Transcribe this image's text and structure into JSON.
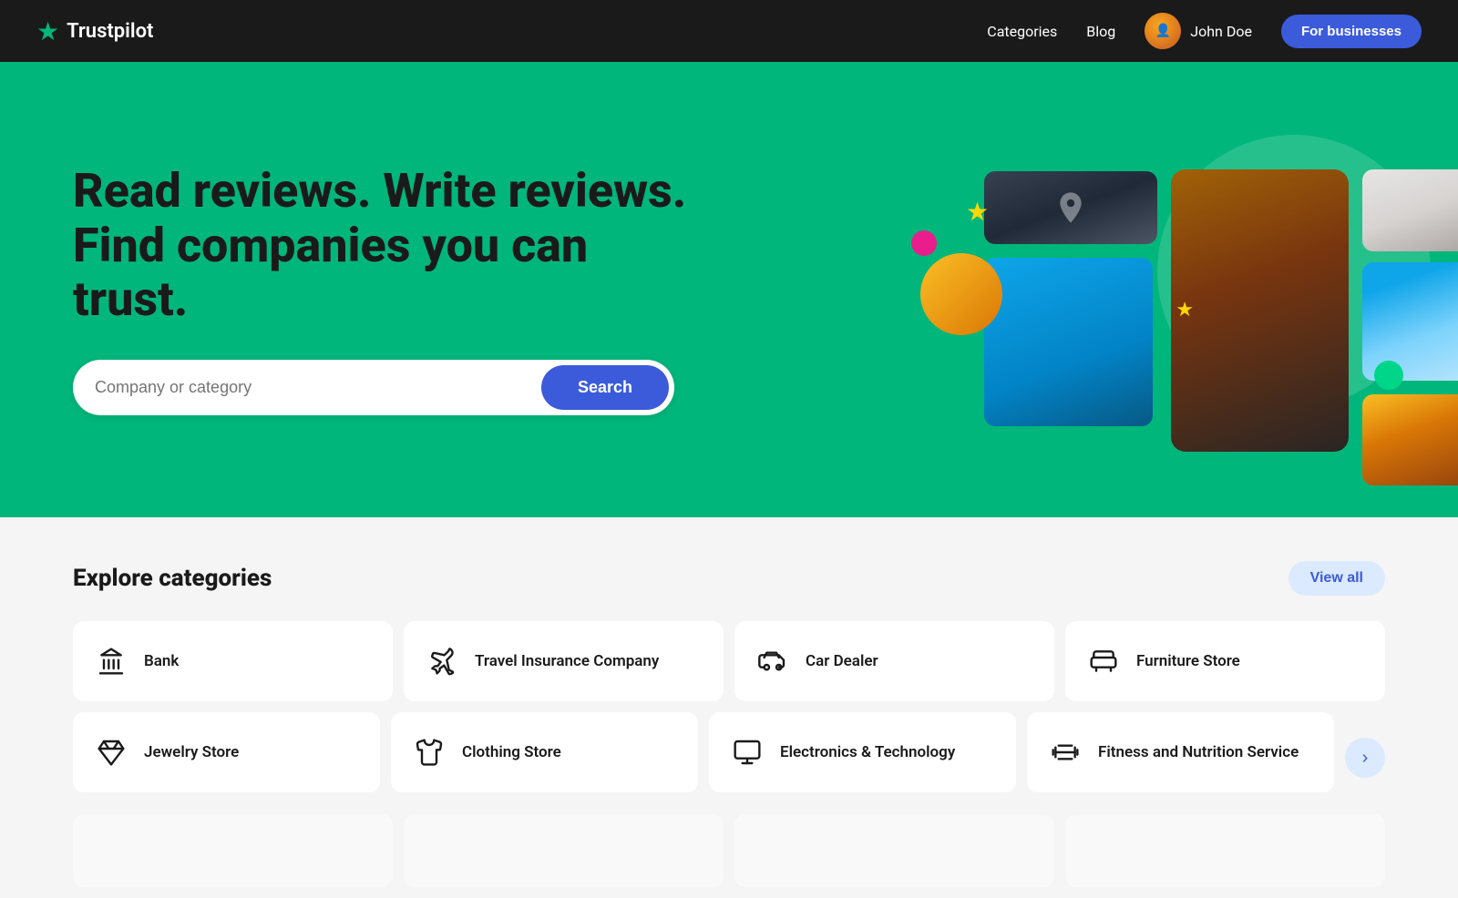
{
  "navbar": {
    "logo_text": "Trustpilot",
    "nav_links": [
      {
        "label": "Categories",
        "id": "categories-link"
      },
      {
        "label": "Blog",
        "id": "blog-link"
      }
    ],
    "user_name": "John Doe",
    "for_businesses_label": "For businesses"
  },
  "hero": {
    "title_line1": "Read reviews. Write reviews.",
    "title_line2": "Find companies you can trust.",
    "search_placeholder": "Company or category",
    "search_button_label": "Search"
  },
  "categories": {
    "section_title": "Explore categories",
    "view_all_label": "View all",
    "items_row1": [
      {
        "id": "bank",
        "label": "Bank",
        "icon": "bank"
      },
      {
        "id": "travel-insurance",
        "label": "Travel Insurance Company",
        "icon": "plane"
      },
      {
        "id": "car-dealer",
        "label": "Car Dealer",
        "icon": "car"
      },
      {
        "id": "furniture-store",
        "label": "Furniture Store",
        "icon": "sofa"
      }
    ],
    "items_row2": [
      {
        "id": "jewelry-store",
        "label": "Jewelry Store",
        "icon": "diamond"
      },
      {
        "id": "clothing-store",
        "label": "Clothing Store",
        "icon": "shirt"
      },
      {
        "id": "electronics",
        "label": "Electronics & Technology",
        "icon": "laptop"
      },
      {
        "id": "fitness",
        "label": "Fitness and Nutrition Service",
        "icon": "dumbbell"
      }
    ],
    "items_row3": [
      {
        "id": "placeholder1",
        "label": "",
        "icon": ""
      },
      {
        "id": "placeholder2",
        "label": "",
        "icon": ""
      },
      {
        "id": "placeholder3",
        "label": "",
        "icon": ""
      },
      {
        "id": "placeholder4",
        "label": "",
        "icon": ""
      }
    ]
  }
}
